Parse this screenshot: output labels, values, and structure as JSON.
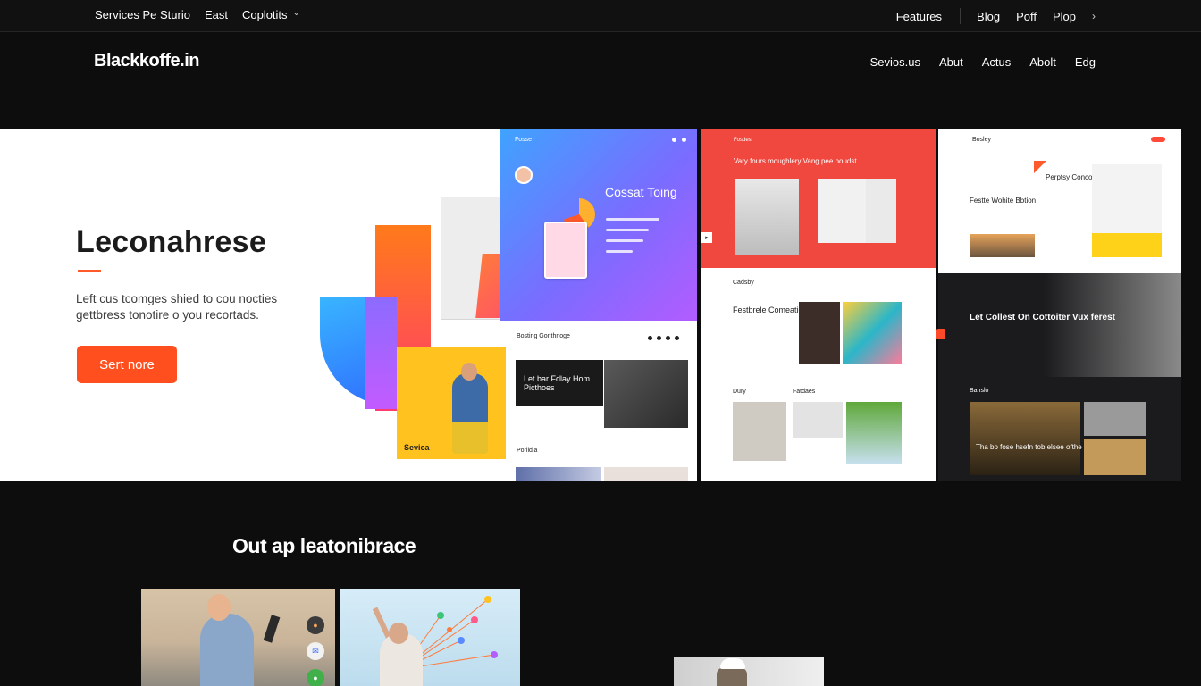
{
  "topbar": {
    "left_items": [
      "Services Pe Sturio",
      "East",
      "Coplotits"
    ],
    "right_items": [
      "Features",
      "Blog",
      "Poff",
      "Plop"
    ]
  },
  "header": {
    "logo": "Blackkoffe.in",
    "nav": [
      "Sevios.us",
      "Abut",
      "Actus",
      "Abolt",
      "Edg"
    ]
  },
  "hero": {
    "title": "Leconahrese",
    "body": "Left cus tcomges shied to cou nocties gettbress tonotire o you recortads.",
    "cta_label": "Sert nore",
    "accent_color": "#ff4f1f"
  },
  "collage": {
    "gradient_card": {
      "label": "Fosse",
      "title": "Cossat Toing"
    },
    "yellow_card_caption": "Sevica",
    "mini_site": {
      "brand": "Bosting Gonthnoge",
      "dark_box_text": "Let bar Fdlay Hom Picthoes",
      "sub_label": "Porlidia"
    }
  },
  "panels": {
    "red": {
      "nav": "Fosdes",
      "headline": "Vary fours moughlery Vang pee poudst"
    },
    "white_mid": {
      "label": "Cadsby",
      "headline": "Festbrele Comeation Sives",
      "label2": "Dury",
      "label3": "Fatdaes"
    },
    "white_right": {
      "brand": "Bosley",
      "headline": "Perptsy Concomenry Nuopy",
      "headline2": "Festte Wohite Bbtion"
    },
    "dark": {
      "headline": "Let Collest On Cottoiter Vux ferest",
      "label": "Banslo",
      "headline2": "Tha bo fose hsefn tob elsee ofthe"
    }
  },
  "section": {
    "title": "Out ap leatonibrace"
  },
  "icons": {
    "chevron": "chevron-down-icon",
    "arrow": "chevron-right-icon"
  }
}
